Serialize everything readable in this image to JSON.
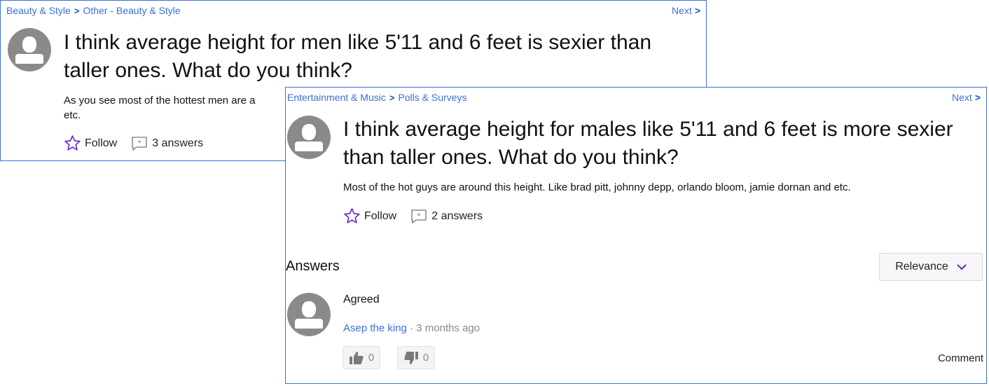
{
  "back": {
    "breadcrumb": {
      "category": "Beauty & Style",
      "subcategory": "Other - Beauty & Style"
    },
    "next_label": "Next",
    "question_title": "I think average height for men like 5'11 and 6 feet is sexier than taller ones. What do you think?",
    "question_body_visible": "As you see most of the hottest men are a",
    "question_body_line2": "etc.",
    "follow_label": "Follow",
    "answers_count": "3 answers"
  },
  "front": {
    "breadcrumb": {
      "category": "Entertainment & Music",
      "subcategory": "Polls & Surveys"
    },
    "next_label": "Next",
    "question_title": "I think average height for males like 5'11 and 6 feet is more sexier than taller ones. What do you think?",
    "question_body": "Most of the hot guys are around this height. Like brad pitt, johnny depp, orlando bloom, jamie dornan and etc.",
    "follow_label": "Follow",
    "answers_count": "2 answers",
    "answers_heading": "Answers",
    "sort_label": "Relevance",
    "answer": {
      "text": "Agreed",
      "author": "Asep the king",
      "separator": "·",
      "time": "3 months ago",
      "upvotes": "0",
      "downvotes": "0",
      "comment_label": "Comment"
    }
  },
  "colors": {
    "link": "#3b6fd9",
    "accent_purple": "#6a1ccf",
    "avatar_gray": "#8a8a8a",
    "panel_border": "#3b6fd9"
  },
  "icons": [
    "chevron-right-icon",
    "user-avatar-icon",
    "star-icon",
    "answers-icon",
    "chevron-down-icon",
    "thumbs-up-icon",
    "thumbs-down-icon"
  ]
}
